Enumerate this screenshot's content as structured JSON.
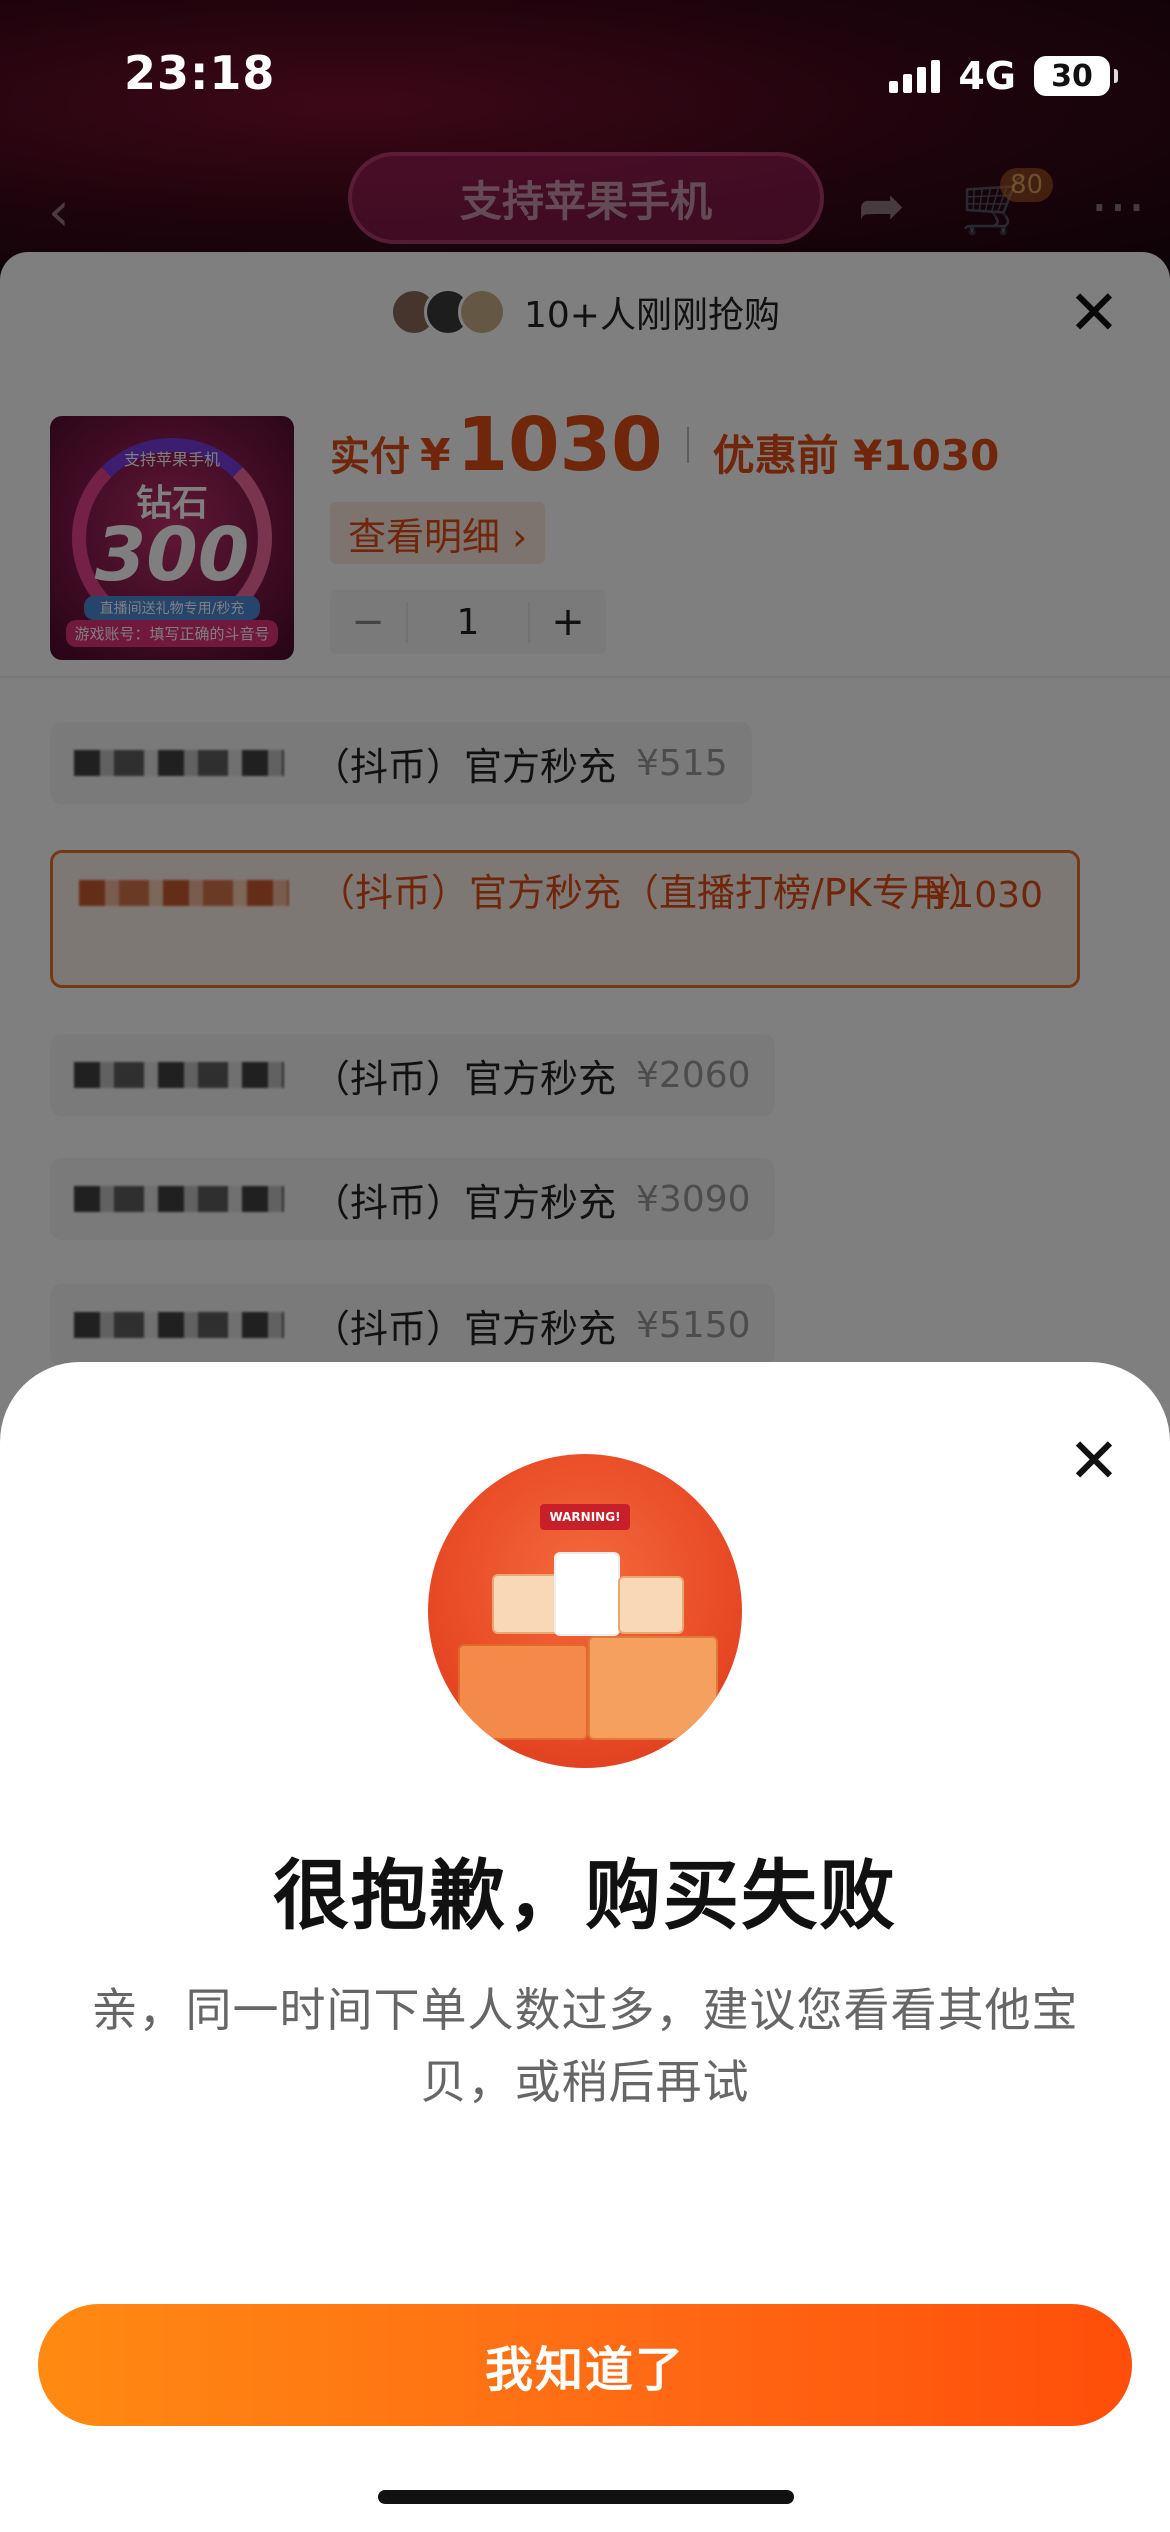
{
  "status_bar": {
    "time": "23:18",
    "network": "4G",
    "battery": "30"
  },
  "nav": {
    "search_text": "支持苹果手机",
    "cart_badge": "80"
  },
  "sheet": {
    "buyers_text": "10+人刚刚抢购",
    "close_glyph": "✕",
    "product_image": {
      "top_text": "支持苹果手机",
      "title": "钻石",
      "number": "300",
      "sub_text": "直播间送礼物专用/秒充",
      "foot_text": "游戏账号：填写正确的斗音号"
    },
    "price": {
      "label": "实付",
      "currency": "¥",
      "value": "1030",
      "original": "优惠前 ¥1030"
    },
    "detail_button": "查看明细 ›",
    "quantity": {
      "minus": "−",
      "value": "1",
      "plus": "+"
    },
    "options": [
      {
        "text": "（抖币）官方秒充",
        "price": "¥515"
      },
      {
        "text": "（抖币）官方秒充（直播打榜/PK专用）",
        "price": "¥1030",
        "selected": true
      },
      {
        "text": "（抖币）官方秒充",
        "price": "¥2060"
      },
      {
        "text": "（抖币）官方秒充",
        "price": "¥3090"
      },
      {
        "text": "（抖币）官方秒充",
        "price": "¥5150"
      }
    ]
  },
  "modal": {
    "close_glyph": "✕",
    "warning_text": "WARNING!",
    "title": "很抱歉，购买失败",
    "message": "亲，同一时间下单人数过多，建议您看看其他宝贝，或稍后再试",
    "confirm_button": "我知道了"
  },
  "colors": {
    "accent": "#e04d14",
    "button_start": "#ff8a12",
    "button_end": "#ff4e0a"
  }
}
